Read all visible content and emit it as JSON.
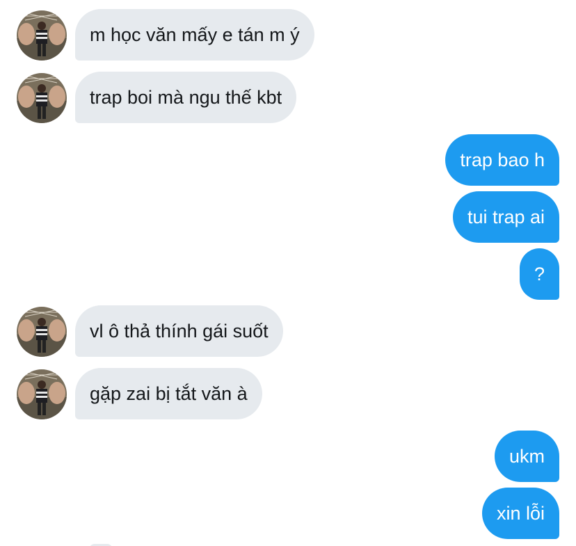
{
  "colors": {
    "incoming_bubble": "#e6eaee",
    "outgoing_bubble": "#1d9bf0",
    "incoming_text": "#14171a",
    "outgoing_text": "#ffffff"
  },
  "avatar_icon": "user-avatar-photo",
  "messages": [
    {
      "direction": "incoming",
      "text": "m học văn mấy e tán m ý"
    },
    {
      "direction": "incoming",
      "text": "trap boi mà ngu thế kbt"
    },
    {
      "direction": "outgoing",
      "text": "trap bao h"
    },
    {
      "direction": "outgoing",
      "text": "tui trap ai"
    },
    {
      "direction": "outgoing",
      "text": "?"
    },
    {
      "direction": "incoming",
      "text": "vl ô thả thính gái suốt"
    },
    {
      "direction": "incoming",
      "text": "gặp zai bị tắt văn à"
    },
    {
      "direction": "outgoing",
      "text": "ukm"
    },
    {
      "direction": "outgoing",
      "text": "xin lỗi"
    }
  ]
}
